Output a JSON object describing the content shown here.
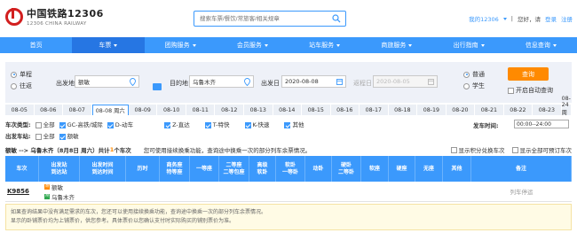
{
  "header": {
    "logo_cn": "中国铁路12306",
    "logo_en": "12306 CHINA RAILWAY",
    "search_placeholder": "搜索车票/餐饮/常旅客/相关规章",
    "my_account": "我的12306",
    "separator": "|",
    "greeting": "您好，请",
    "login": "登录",
    "register": "注册"
  },
  "nav": [
    {
      "label": "首页",
      "dropdown": false,
      "active": false
    },
    {
      "label": "车票",
      "dropdown": true,
      "active": true
    },
    {
      "label": "团购服务",
      "dropdown": true,
      "active": false
    },
    {
      "label": "会员服务",
      "dropdown": true,
      "active": false
    },
    {
      "label": "站车服务",
      "dropdown": true,
      "active": false
    },
    {
      "label": "商旅服务",
      "dropdown": true,
      "active": false
    },
    {
      "label": "出行指南",
      "dropdown": true,
      "active": false
    },
    {
      "label": "信息查询",
      "dropdown": true,
      "active": false
    }
  ],
  "query": {
    "oneway": "单程",
    "roundtrip": "往返",
    "from_label": "出发地",
    "from_value": "额敏",
    "to_label": "目的地",
    "to_value": "乌鲁木齐",
    "date_label": "出发日",
    "date_value": "2020-08-08",
    "return_label": "返程日",
    "return_value": "2020-08-05",
    "normal": "普通",
    "student": "学生",
    "query_btn": "查询",
    "auto_query": "开启自动查询"
  },
  "dates": [
    "08-05",
    "08-06",
    "08-07",
    "08-08 周六",
    "08-09",
    "08-10",
    "08-11",
    "08-12",
    "08-13",
    "08-14",
    "08-15",
    "08-16",
    "08-17",
    "08-18",
    "08-19",
    "08-20",
    "08-21",
    "08-22",
    "08-23",
    "08-24 周一"
  ],
  "filters": {
    "type_label": "车次类型:",
    "types": [
      "全部",
      "GC-高铁/城际",
      "D-动车",
      "Z-直达",
      "T-特快",
      "K-快速",
      "其他"
    ],
    "station_label": "出发车站:",
    "stations": [
      "全部",
      "额敏"
    ],
    "depart_time_label": "发车时间:",
    "depart_time_value": "00:00--24:00"
  },
  "summary": {
    "route": "额敏 --> 乌鲁木齐（8月8日 周六）共计",
    "count": "1",
    "unit": "个车次",
    "tip": "您可使用接续换乘功能，查询途中换乘一次的部分列车余票情况。",
    "opt1": "显示积分兑换车次",
    "opt2": "显示全部可预订车次"
  },
  "table": {
    "headers": [
      "车次",
      "出发站\n到达站",
      "出发时间\n到达时间",
      "历时",
      "商务座\n特等座",
      "一等座",
      "二等座\n二等包座",
      "高级\n软卧",
      "软卧\n一等卧",
      "动卧",
      "硬卧\n二等卧",
      "软座",
      "硬座",
      "无座",
      "其他",
      "备注"
    ],
    "row": {
      "train": "K9856",
      "from": "额敏",
      "to": "乌鲁木齐",
      "from_tag": "始",
      "to_tag": "终",
      "remark": "列车停运"
    }
  },
  "notice": {
    "line1": "如果查询结果中没有满足需求的车次，您还可以使用接续换乘功能，查询途中换乘一次的部分列车余票情况。",
    "line2": "显示的卧铺票价均为上铺票价，供您参考。具体票价以您确认支付时实际购买的铺别票价为准。"
  }
}
